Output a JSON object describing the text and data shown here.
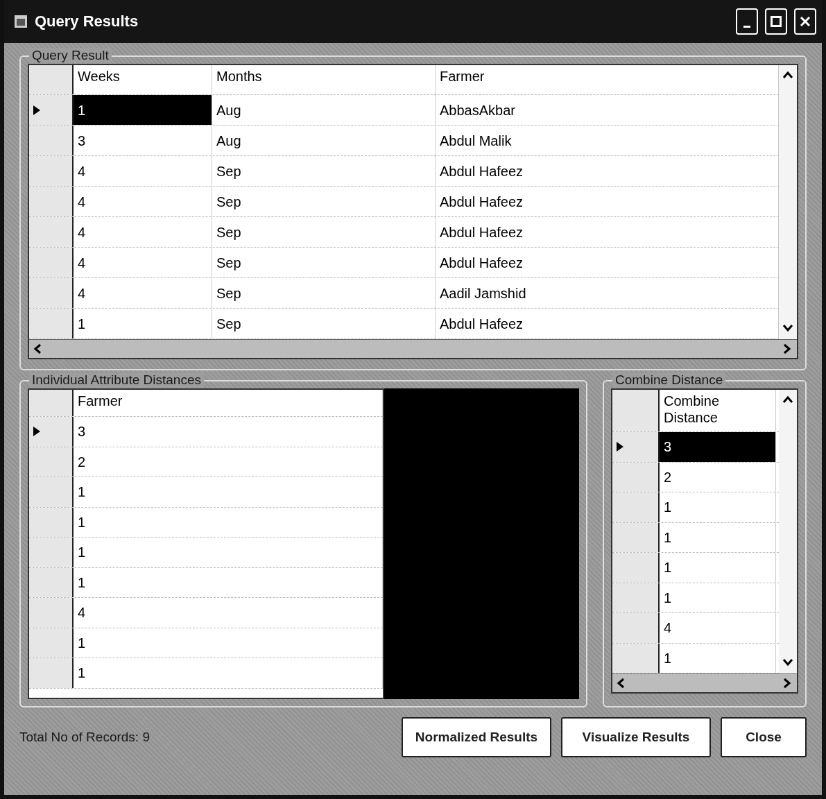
{
  "window": {
    "title": "Query Results"
  },
  "query_group": {
    "title": "Query Result",
    "columns": [
      "Weeks",
      "Months",
      "Farmer"
    ],
    "rows": [
      {
        "cells": [
          "1",
          "Aug",
          "AbbasAkbar"
        ],
        "selected": true
      },
      {
        "cells": [
          "3",
          "Aug",
          "Abdul Malik"
        ],
        "selected": false
      },
      {
        "cells": [
          "4",
          "Sep",
          "Abdul Hafeez"
        ],
        "selected": false
      },
      {
        "cells": [
          "4",
          "Sep",
          "Abdul Hafeez"
        ],
        "selected": false
      },
      {
        "cells": [
          "4",
          "Sep",
          "Abdul Hafeez"
        ],
        "selected": false
      },
      {
        "cells": [
          "4",
          "Sep",
          "Abdul Hafeez"
        ],
        "selected": false
      },
      {
        "cells": [
          "4",
          "Sep",
          "Aadil Jamshid"
        ],
        "selected": false
      },
      {
        "cells": [
          "1",
          "Sep",
          "Abdul Hafeez"
        ],
        "selected": false
      }
    ]
  },
  "distance_group": {
    "title": "Individual Attribute Distances",
    "columns": [
      "Farmer"
    ],
    "rows": [
      {
        "cells": [
          "3"
        ],
        "selected": false
      },
      {
        "cells": [
          "2"
        ],
        "selected": false
      },
      {
        "cells": [
          "1"
        ],
        "selected": false
      },
      {
        "cells": [
          "1"
        ],
        "selected": false
      },
      {
        "cells": [
          "1"
        ],
        "selected": false
      },
      {
        "cells": [
          "1"
        ],
        "selected": false
      },
      {
        "cells": [
          "4"
        ],
        "selected": false
      },
      {
        "cells": [
          "1"
        ],
        "selected": false
      },
      {
        "cells": [
          "1"
        ],
        "selected": false
      }
    ]
  },
  "combine_group": {
    "title": "Combine Distance",
    "columns": [
      "Combine Distance"
    ],
    "rows": [
      {
        "cells": [
          "3"
        ],
        "selected": true
      },
      {
        "cells": [
          "2"
        ],
        "selected": false
      },
      {
        "cells": [
          "1"
        ],
        "selected": false
      },
      {
        "cells": [
          "1"
        ],
        "selected": false
      },
      {
        "cells": [
          "1"
        ],
        "selected": false
      },
      {
        "cells": [
          "1"
        ],
        "selected": false
      },
      {
        "cells": [
          "4"
        ],
        "selected": false
      },
      {
        "cells": [
          "1"
        ],
        "selected": false
      }
    ]
  },
  "status": "Total No of Records: 9",
  "buttons": [
    "Normalized Results",
    "Visualize Results",
    "Close"
  ]
}
